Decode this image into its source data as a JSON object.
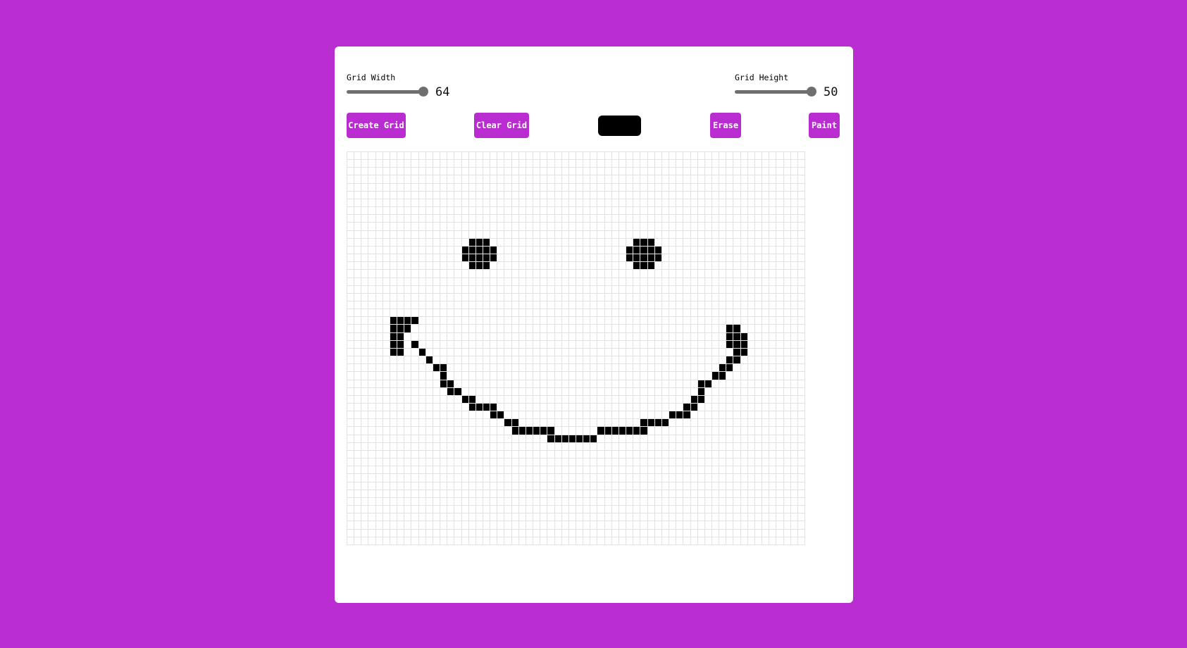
{
  "colors": {
    "background": "#b92dd0",
    "card": "#ffffff",
    "button": "#b92dd0",
    "button_text": "#ffffff",
    "paint_color": "#000000",
    "grid_line": "#e2e2e2"
  },
  "controls": {
    "width_label": "Grid Width",
    "width_value": "64",
    "width_fraction": 0.95,
    "height_label": "Grid Height",
    "height_value": "50",
    "height_fraction": 0.95
  },
  "toolbar": {
    "create_label": "Create Grid",
    "clear_label": "Clear Grid",
    "erase_label": "Erase",
    "paint_label": "Paint"
  },
  "grid": {
    "cols": 64,
    "rows": 50,
    "painted": [
      [
        11,
        17
      ],
      [
        11,
        18
      ],
      [
        11,
        19
      ],
      [
        12,
        16
      ],
      [
        12,
        17
      ],
      [
        12,
        18
      ],
      [
        12,
        19
      ],
      [
        12,
        20
      ],
      [
        13,
        16
      ],
      [
        13,
        17
      ],
      [
        13,
        18
      ],
      [
        13,
        19
      ],
      [
        13,
        20
      ],
      [
        14,
        17
      ],
      [
        14,
        18
      ],
      [
        14,
        19
      ],
      [
        11,
        40
      ],
      [
        11,
        41
      ],
      [
        11,
        42
      ],
      [
        12,
        39
      ],
      [
        12,
        40
      ],
      [
        12,
        41
      ],
      [
        12,
        42
      ],
      [
        12,
        43
      ],
      [
        13,
        39
      ],
      [
        13,
        40
      ],
      [
        13,
        41
      ],
      [
        13,
        42
      ],
      [
        13,
        43
      ],
      [
        14,
        40
      ],
      [
        14,
        41
      ],
      [
        14,
        42
      ],
      [
        21,
        6
      ],
      [
        21,
        7
      ],
      [
        21,
        8
      ],
      [
        21,
        9
      ],
      [
        22,
        6
      ],
      [
        22,
        7
      ],
      [
        22,
        8
      ],
      [
        23,
        6
      ],
      [
        23,
        7
      ],
      [
        24,
        6
      ],
      [
        24,
        7
      ],
      [
        24,
        9
      ],
      [
        25,
        6
      ],
      [
        25,
        7
      ],
      [
        25,
        10
      ],
      [
        26,
        11
      ],
      [
        27,
        12
      ],
      [
        27,
        13
      ],
      [
        28,
        13
      ],
      [
        29,
        13
      ],
      [
        29,
        14
      ],
      [
        30,
        14
      ],
      [
        30,
        15
      ],
      [
        31,
        16
      ],
      [
        31,
        17
      ],
      [
        32,
        17
      ],
      [
        32,
        18
      ],
      [
        32,
        19
      ],
      [
        32,
        20
      ],
      [
        33,
        20
      ],
      [
        33,
        21
      ],
      [
        34,
        22
      ],
      [
        34,
        23
      ],
      [
        35,
        23
      ],
      [
        35,
        24
      ],
      [
        35,
        25
      ],
      [
        35,
        26
      ],
      [
        35,
        27
      ],
      [
        35,
        28
      ],
      [
        36,
        28
      ],
      [
        36,
        29
      ],
      [
        36,
        30
      ],
      [
        36,
        31
      ],
      [
        36,
        32
      ],
      [
        36,
        33
      ],
      [
        36,
        34
      ],
      [
        35,
        35
      ],
      [
        35,
        36
      ],
      [
        35,
        37
      ],
      [
        35,
        38
      ],
      [
        35,
        39
      ],
      [
        35,
        40
      ],
      [
        35,
        41
      ],
      [
        34,
        41
      ],
      [
        34,
        42
      ],
      [
        34,
        43
      ],
      [
        34,
        44
      ],
      [
        33,
        45
      ],
      [
        33,
        46
      ],
      [
        33,
        47
      ],
      [
        32,
        47
      ],
      [
        32,
        48
      ],
      [
        31,
        48
      ],
      [
        31,
        49
      ],
      [
        30,
        49
      ],
      [
        29,
        49
      ],
      [
        29,
        50
      ],
      [
        28,
        51
      ],
      [
        28,
        52
      ],
      [
        27,
        52
      ],
      [
        27,
        53
      ],
      [
        26,
        53
      ],
      [
        26,
        54
      ],
      [
        22,
        53
      ],
      [
        22,
        54
      ],
      [
        23,
        53
      ],
      [
        23,
        54
      ],
      [
        23,
        55
      ],
      [
        24,
        53
      ],
      [
        24,
        54
      ],
      [
        24,
        55
      ],
      [
        25,
        54
      ],
      [
        25,
        55
      ]
    ]
  }
}
